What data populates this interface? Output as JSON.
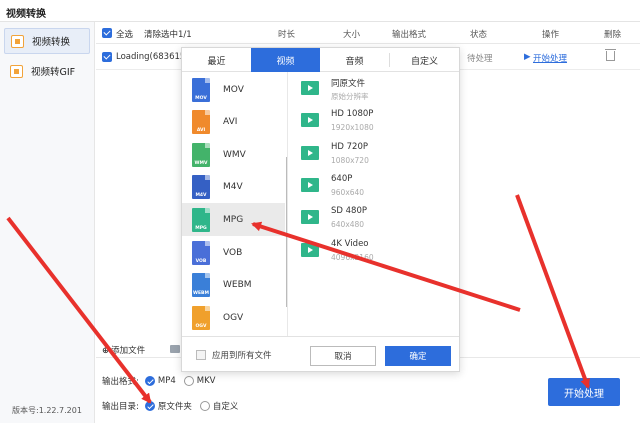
{
  "app": {
    "title": "视频转换",
    "version": "版本号:1.22.7.201"
  },
  "sidebar": {
    "items": [
      {
        "label": "视频转换"
      },
      {
        "label": "视频转GIF"
      }
    ]
  },
  "table": {
    "select_all": "全选",
    "clear_selected": "清除选中1/1",
    "headers": {
      "duration": "时长",
      "size": "大小",
      "output_format": "输出格式",
      "status": "状态",
      "action": "操作",
      "delete": "删除"
    },
    "rows": [
      {
        "name": "Loading(683615",
        "status": "待处理",
        "action": "开始处理"
      }
    ]
  },
  "add_file": "添加文件",
  "output": {
    "format_label": "输出格式:",
    "format_options": [
      "MP4",
      "MKV"
    ],
    "format_selected": "MP4",
    "dir_label": "输出目录:",
    "dir_options": [
      "原文件夹",
      "自定义"
    ],
    "dir_selected": "原文件夹"
  },
  "start_button": "开始处理",
  "popup": {
    "tabs": [
      "最近",
      "视频",
      "音频",
      "自定义"
    ],
    "active_tab": "视频",
    "formats": [
      {
        "name": "MOV",
        "color": "#3a6fd8"
      },
      {
        "name": "AVI",
        "color": "#f08a2c"
      },
      {
        "name": "WMV",
        "color": "#43b36a"
      },
      {
        "name": "M4V",
        "color": "#3560c4"
      },
      {
        "name": "MPG",
        "color": "#2fb68a",
        "selected": true
      },
      {
        "name": "VOB",
        "color": "#4a6fd8"
      },
      {
        "name": "WEBM",
        "color": "#3a7fd8"
      },
      {
        "name": "OGV",
        "color": "#f0a02c"
      }
    ],
    "resolutions": [
      {
        "title": "同原文件",
        "sub": "原始分辨率"
      },
      {
        "title": "HD 1080P",
        "sub": "1920x1080"
      },
      {
        "title": "HD 720P",
        "sub": "1080x720"
      },
      {
        "title": "640P",
        "sub": "960x640"
      },
      {
        "title": "SD 480P",
        "sub": "640x480"
      },
      {
        "title": "4K Video",
        "sub": "4096x2160"
      }
    ],
    "apply_all": "应用到所有文件",
    "cancel": "取消",
    "ok": "确定"
  },
  "colors": {
    "accent": "#2d6ddc",
    "annotation_arrow": "#e8312c",
    "selected_row": "#eaeaea"
  }
}
